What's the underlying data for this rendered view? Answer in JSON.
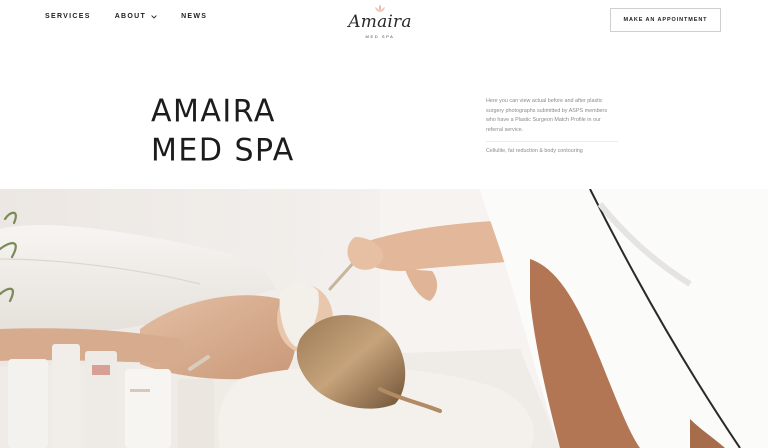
{
  "header": {
    "nav": [
      {
        "label": "SERVICES"
      },
      {
        "label": "ABOUT"
      },
      {
        "label": "NEWS"
      }
    ],
    "logo": {
      "name": "Amaira",
      "subtitle": "MED SPA"
    },
    "cta_label": "MAKE AN APPOINTMENT"
  },
  "hero": {
    "title_line1": "AMAIRA",
    "title_line2": "MED SPA",
    "description": "Here you can view actual before and after plastic surgery photographs submitted by ASPS members who have a Plastic Surgeon Match Profile in our referral service.",
    "tag": "Cellulite, fat reduction & body contouring"
  },
  "colors": {
    "text": "#1c1c1c",
    "muted": "#8a8a8a",
    "accent_flower": "#e7b9a8"
  }
}
